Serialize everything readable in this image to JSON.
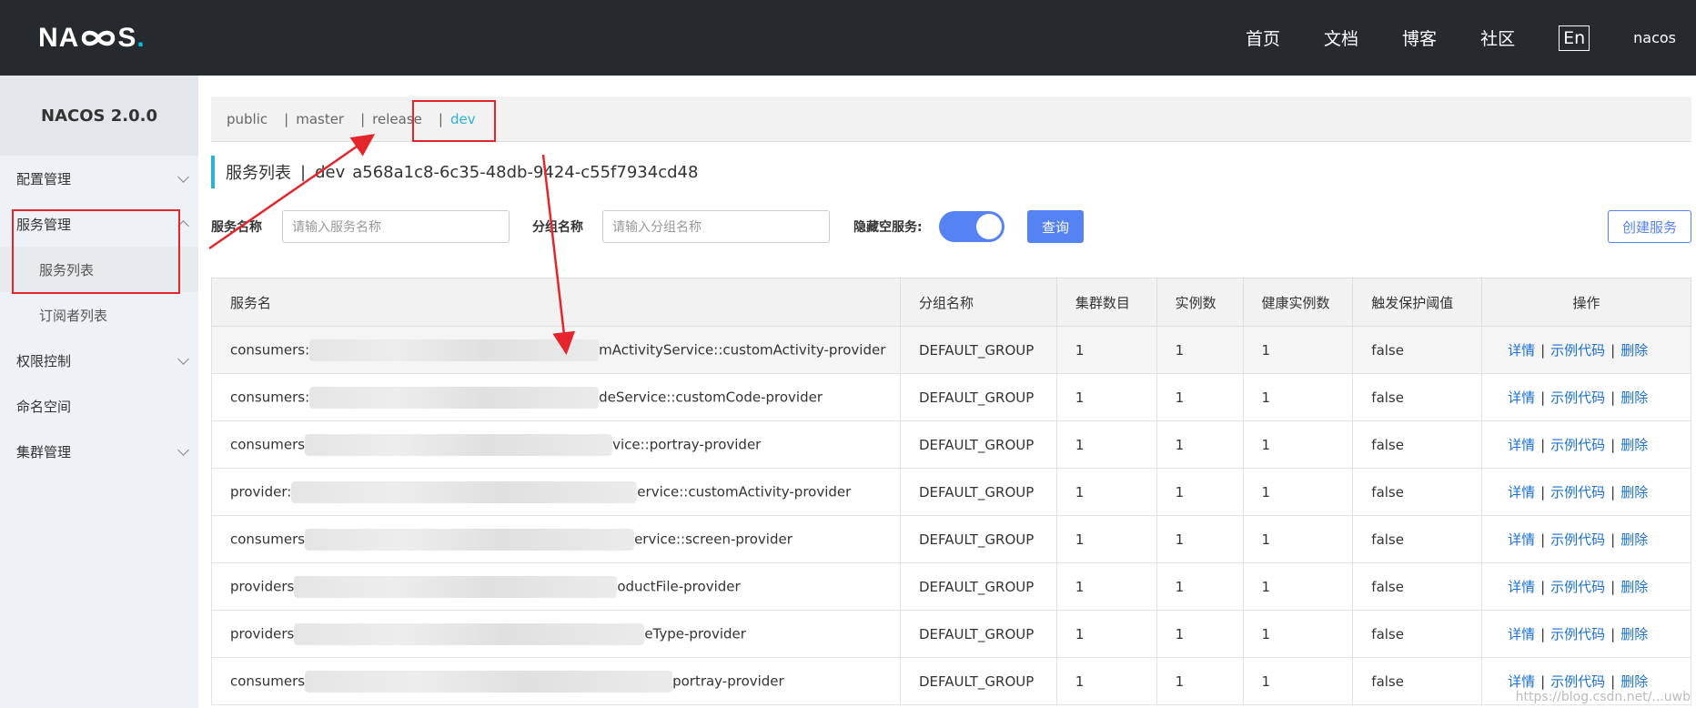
{
  "topbar": {
    "logo": {
      "left": "NA",
      "right": "S",
      "dot": "."
    },
    "nav": [
      "首页",
      "文档",
      "博客",
      "社区"
    ],
    "lang": "En",
    "user": "nacos"
  },
  "sidebar": {
    "title": "NACOS 2.0.0",
    "items": [
      {
        "label": "配置管理",
        "chevron": "down"
      },
      {
        "label": "服务管理",
        "chevron": "up"
      },
      {
        "label": "服务列表",
        "sub": true,
        "active": true
      },
      {
        "label": "订阅者列表",
        "sub": true
      },
      {
        "label": "权限控制",
        "chevron": "down"
      },
      {
        "label": "命名空间"
      },
      {
        "label": "集群管理",
        "chevron": "down"
      }
    ]
  },
  "namespaces": [
    "public",
    "master",
    "release",
    "dev"
  ],
  "active_namespace": "dev",
  "header": {
    "title": "服务列表",
    "separator": "|",
    "namespace": "dev",
    "namespace_id": "a568a1c8-6c35-48db-9424-c55f7934cd48"
  },
  "filters": {
    "service_label": "服务名称",
    "service_placeholder": "请输入服务名称",
    "group_label": "分组名称",
    "group_placeholder": "请输入分组名称",
    "hide_empty_label": "隐藏空服务:",
    "hide_empty_on": true,
    "query_label": "查询",
    "create_label": "创建服务"
  },
  "table": {
    "columns": [
      "服务名",
      "分组名称",
      "集群数目",
      "实例数",
      "健康实例数",
      "触发保护阈值",
      "操作"
    ],
    "actions": [
      "详情",
      "示例代码",
      "删除"
    ],
    "rows": [
      {
        "prefix": "consumers:",
        "suffix": "mActivityService::customActivity-provider",
        "group": "DEFAULT_GROUP",
        "clusters": "1",
        "instances": "1",
        "healthy": "1",
        "threshold": "false"
      },
      {
        "prefix": "consumers:",
        "suffix": "deService::customCode-provider",
        "group": "DEFAULT_GROUP",
        "clusters": "1",
        "instances": "1",
        "healthy": "1",
        "threshold": "false"
      },
      {
        "prefix": "consumers",
        "suffix": "vice::portray-provider",
        "group": "DEFAULT_GROUP",
        "clusters": "1",
        "instances": "1",
        "healthy": "1",
        "threshold": "false"
      },
      {
        "prefix": "provider:",
        "suffix": "ervice::customActivity-provider",
        "group": "DEFAULT_GROUP",
        "clusters": "1",
        "instances": "1",
        "healthy": "1",
        "threshold": "false"
      },
      {
        "prefix": "consumers",
        "suffix": "ervice::screen-provider",
        "group": "DEFAULT_GROUP",
        "clusters": "1",
        "instances": "1",
        "healthy": "1",
        "threshold": "false"
      },
      {
        "prefix": "providers",
        "suffix": "oductFile-provider",
        "group": "DEFAULT_GROUP",
        "clusters": "1",
        "instances": "1",
        "healthy": "1",
        "threshold": "false"
      },
      {
        "prefix": "providers",
        "suffix": "eType-provider",
        "group": "DEFAULT_GROUP",
        "clusters": "1",
        "instances": "1",
        "healthy": "1",
        "threshold": "false"
      },
      {
        "prefix": "consumers",
        "suffix": "portray-provider",
        "group": "DEFAULT_GROUP",
        "clusters": "1",
        "instances": "1",
        "healthy": "1",
        "threshold": "false"
      }
    ]
  },
  "watermark": "https://blog.csdn.net/...uwb"
}
